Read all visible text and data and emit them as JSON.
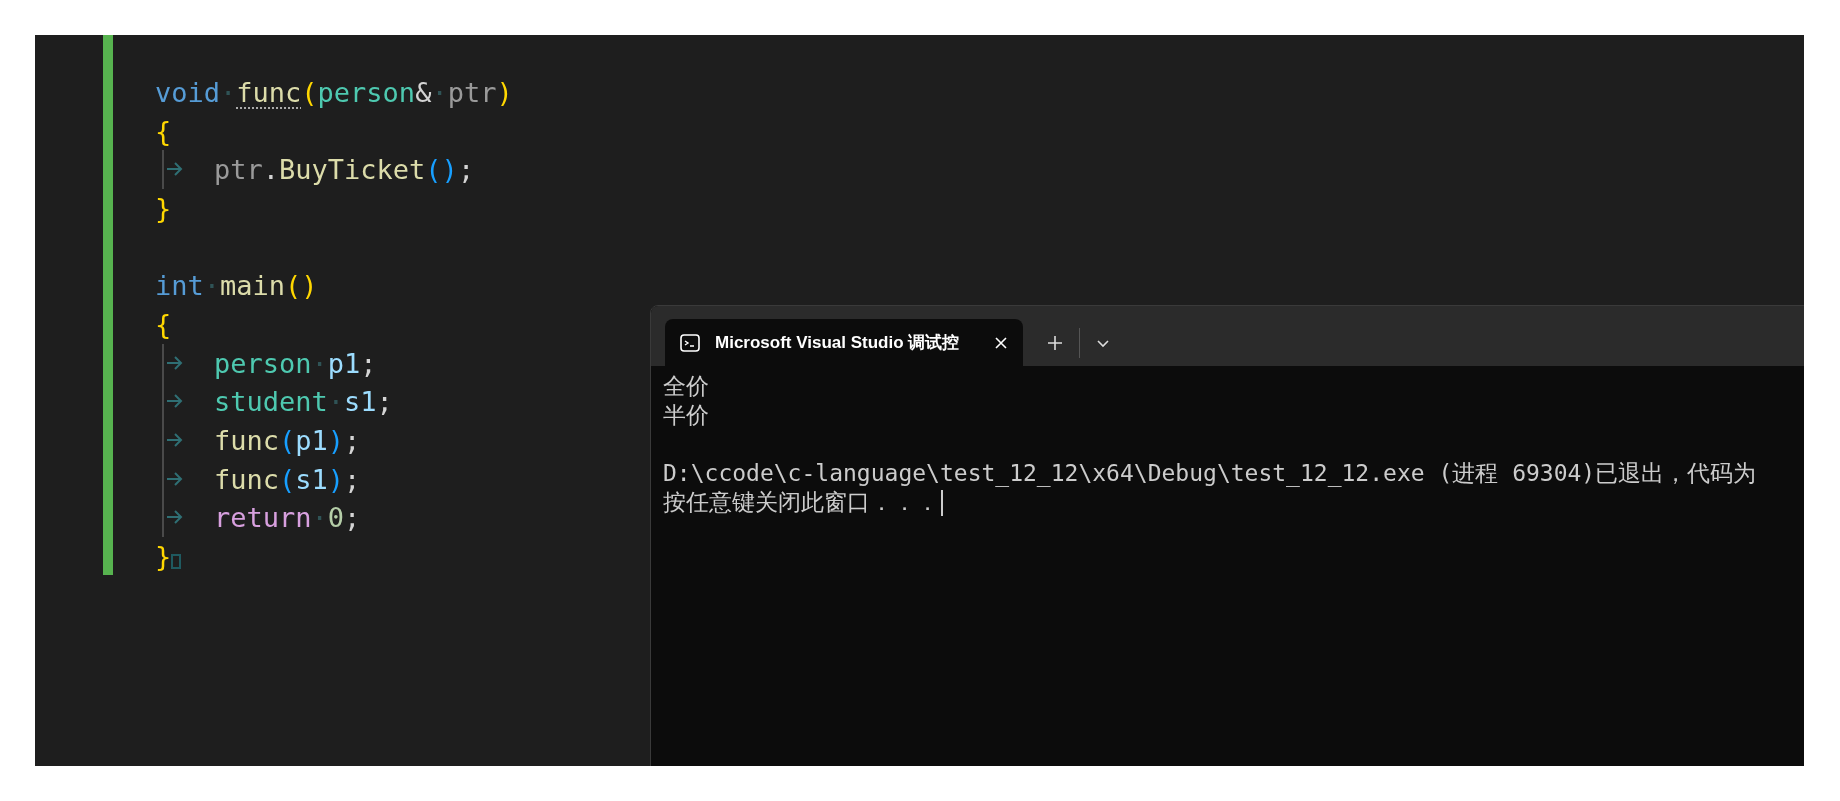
{
  "editor": {
    "lines": [
      {
        "kind": "code",
        "tokens": [
          {
            "kind": "keyword",
            "text": "void"
          },
          {
            "kind": "ws",
            "text": "·"
          },
          {
            "kind": "func",
            "text": "func",
            "squiggle": true
          },
          {
            "kind": "brace",
            "text": "("
          },
          {
            "kind": "type",
            "text": "person"
          },
          {
            "kind": "punct",
            "text": "&"
          },
          {
            "kind": "ws",
            "text": "·"
          },
          {
            "kind": "param",
            "text": "ptr"
          },
          {
            "kind": "brace",
            "text": ")"
          }
        ]
      },
      {
        "kind": "code",
        "tokens": [
          {
            "kind": "brace",
            "text": "{"
          }
        ]
      },
      {
        "kind": "code",
        "tokens": [
          {
            "kind": "tab"
          },
          {
            "kind": "param",
            "text": "ptr"
          },
          {
            "kind": "punct",
            "text": "."
          },
          {
            "kind": "func",
            "text": "BuyTicket"
          },
          {
            "kind": "paren",
            "text": "()"
          },
          {
            "kind": "punct",
            "text": ";"
          }
        ]
      },
      {
        "kind": "code",
        "tokens": [
          {
            "kind": "brace",
            "text": "}"
          }
        ]
      },
      {
        "kind": "blank"
      },
      {
        "kind": "code",
        "tokens": [
          {
            "kind": "keyword",
            "text": "int"
          },
          {
            "kind": "ws",
            "text": "·"
          },
          {
            "kind": "func",
            "text": "main"
          },
          {
            "kind": "brace",
            "text": "()"
          }
        ]
      },
      {
        "kind": "code",
        "tokens": [
          {
            "kind": "brace",
            "text": "{"
          }
        ]
      },
      {
        "kind": "code",
        "tokens": [
          {
            "kind": "tab"
          },
          {
            "kind": "type",
            "text": "person"
          },
          {
            "kind": "ws",
            "text": "·"
          },
          {
            "kind": "var",
            "text": "p1"
          },
          {
            "kind": "punct",
            "text": ";"
          }
        ]
      },
      {
        "kind": "code",
        "tokens": [
          {
            "kind": "tab"
          },
          {
            "kind": "type",
            "text": "student"
          },
          {
            "kind": "ws",
            "text": "·"
          },
          {
            "kind": "var",
            "text": "s1"
          },
          {
            "kind": "punct",
            "text": ";"
          }
        ]
      },
      {
        "kind": "code",
        "tokens": [
          {
            "kind": "tab"
          },
          {
            "kind": "func",
            "text": "func"
          },
          {
            "kind": "paren",
            "text": "("
          },
          {
            "kind": "var",
            "text": "p1"
          },
          {
            "kind": "paren",
            "text": ")"
          },
          {
            "kind": "punct",
            "text": ";"
          }
        ]
      },
      {
        "kind": "code",
        "tokens": [
          {
            "kind": "tab"
          },
          {
            "kind": "func",
            "text": "func"
          },
          {
            "kind": "paren",
            "text": "("
          },
          {
            "kind": "var",
            "text": "s1"
          },
          {
            "kind": "paren",
            "text": ")"
          },
          {
            "kind": "punct",
            "text": ";"
          }
        ]
      },
      {
        "kind": "code",
        "tokens": [
          {
            "kind": "tab"
          },
          {
            "kind": "control",
            "text": "return"
          },
          {
            "kind": "ws",
            "text": "·"
          },
          {
            "kind": "number",
            "text": "0"
          },
          {
            "kind": "punct",
            "text": ";"
          }
        ]
      },
      {
        "kind": "code",
        "tokens": [
          {
            "kind": "brace",
            "text": "}"
          },
          {
            "kind": "end-marker"
          }
        ]
      }
    ]
  },
  "console": {
    "tabs": [
      {
        "title": "Microsoft Visual Studio 调试控",
        "selected": true
      }
    ],
    "output": [
      {
        "kind": "text",
        "text": "全价"
      },
      {
        "kind": "text",
        "text": "半价"
      },
      {
        "kind": "blank"
      },
      {
        "kind": "text",
        "text": "D:\\ccode\\c-language\\test_12_12\\x64\\Debug\\test_12_12.exe (进程 69304)已退出，代码为"
      },
      {
        "kind": "text",
        "text": "按任意键关闭此窗口．．．"
      }
    ],
    "cursor": true
  }
}
